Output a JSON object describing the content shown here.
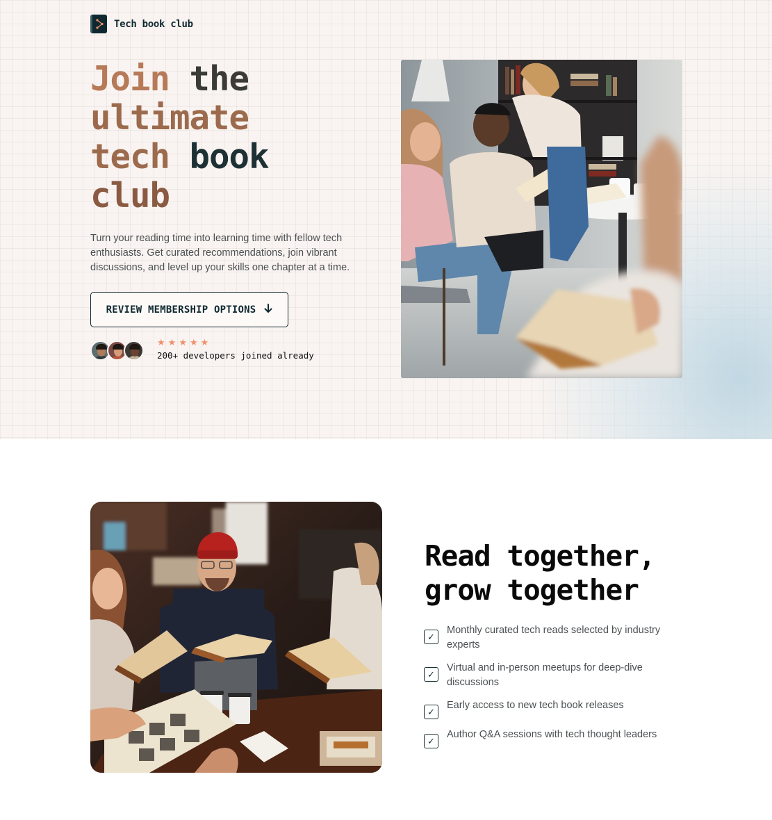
{
  "brand": {
    "name": "Tech book club",
    "logo_icon": "book-icon"
  },
  "hero": {
    "headline": {
      "w1": "Join",
      "w2": "the",
      "w3": "ultimate",
      "w4": "tech",
      "w5": "book",
      "w6": "club"
    },
    "lead": "Turn your reading time into learning time with fellow tech enthusiasts. Get curated recommendations, join vibrant discussions, and level up your skills one chapter at a time.",
    "cta_label": "REVIEW MEMBERSHIP OPTIONS",
    "cta_icon": "arrow-down-icon",
    "rating_stars": 5,
    "social_proof": "200+ developers joined already",
    "colors": {
      "accent": "#b77a58",
      "dark": "#0f2830",
      "star": "#f0916c",
      "background": "#f9f4f1"
    }
  },
  "features": {
    "title_line1": "Read together,",
    "title_line2": "grow together",
    "items": [
      {
        "text": "Monthly curated tech reads selected by industry experts"
      },
      {
        "text": "Virtual and in-person meetups for deep-dive discussions"
      },
      {
        "text": "Early access to new tech book releases"
      },
      {
        "text": "Author Q&A sessions with tech thought leaders"
      }
    ]
  }
}
